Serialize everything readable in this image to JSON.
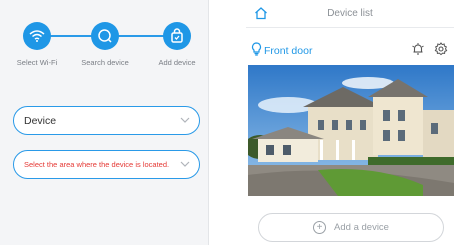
{
  "setup": {
    "steps": [
      {
        "label": "Select Wi-Fi",
        "icon": "wifi-icon"
      },
      {
        "label": "Search device",
        "icon": "search-device-icon"
      },
      {
        "label": "Add device",
        "icon": "add-device-icon"
      }
    ],
    "device_select": {
      "value": "Device"
    },
    "area_select": {
      "value": "Select the area where the device is located."
    }
  },
  "device_list": {
    "title": "Device list",
    "device": {
      "name": "Front door"
    },
    "add_button": {
      "label": "Add a device"
    }
  },
  "colors": {
    "accent": "#1f97e6",
    "hint_red": "#e53935"
  }
}
